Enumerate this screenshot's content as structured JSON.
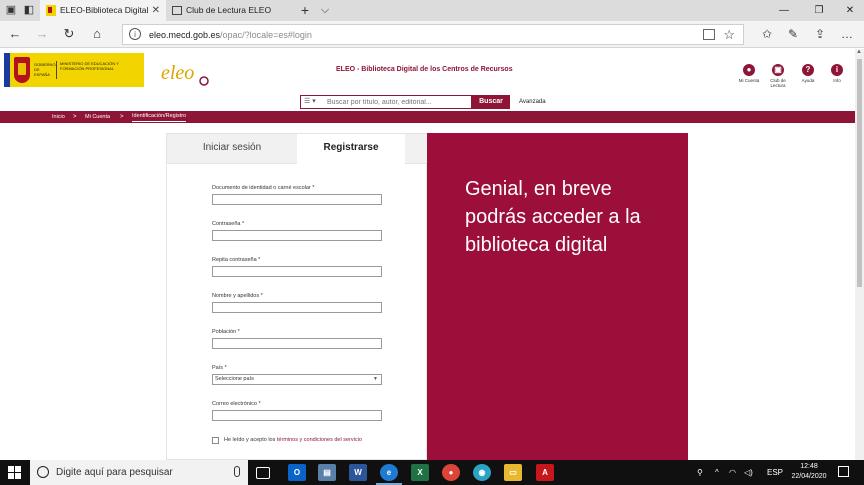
{
  "browser": {
    "tabs": [
      {
        "label": "ELEO-Biblioteca Digital",
        "active": true
      },
      {
        "label": "Club de Lectura ELEO",
        "active": false
      }
    ],
    "new_tab": "+",
    "tab_list": "⌵",
    "url_host": "eleo.mecd.gob.es",
    "url_path": "/opac/?locale=es#login"
  },
  "header": {
    "gov_short": "GOBIERNO DE ESPAÑA",
    "ministry": "MINISTERIO DE EDUCACIÓN Y FORMACIÓN PROFESIONAL",
    "logo_text": "eleo",
    "site_title": "ELEO - Biblioteca Digital de los Centros de Recursos",
    "icons": [
      {
        "label": "Mi Cuenta",
        "glyph": "●"
      },
      {
        "label": "Club de Lectura",
        "glyph": "▣"
      },
      {
        "label": "Ayuda",
        "glyph": "?"
      },
      {
        "label": "Info",
        "glyph": "i"
      }
    ]
  },
  "search": {
    "selector": "☰ ▾",
    "placeholder": "Buscar por título, autor, editorial...",
    "button": "Buscar",
    "advanced": "Avanzada"
  },
  "breadcrumb": [
    "Inicio",
    "Mi Cuenta",
    "Identificación/Registro"
  ],
  "form": {
    "tab_login": "Iniciar sesión",
    "tab_register": "Registrarse",
    "fields": [
      {
        "label": "Documento de identidad o carné escolar *",
        "type": "text"
      },
      {
        "label": "Contraseña *",
        "type": "password"
      },
      {
        "label": "Repita contraseña *",
        "type": "password"
      },
      {
        "label": "Nombre y apellidos *",
        "type": "text"
      },
      {
        "label": "Población *",
        "type": "text"
      },
      {
        "label": "País *",
        "type": "select",
        "value": "Seleccione país"
      },
      {
        "label": "Correo electrónico *",
        "type": "text"
      }
    ],
    "terms_prefix": "He leído y acepto los",
    "terms_link": "términos y condiciones del servicio"
  },
  "promo": {
    "text": "Genial, en breve podrás acceder a la biblioteca digital"
  },
  "taskbar": {
    "search_text": "Digite aquí para pesquisar",
    "language": "ESP",
    "time": "12:48",
    "date": "22/04/2020"
  },
  "colors": {
    "brand": "#8e1536",
    "promo": "#9c0f3a"
  }
}
